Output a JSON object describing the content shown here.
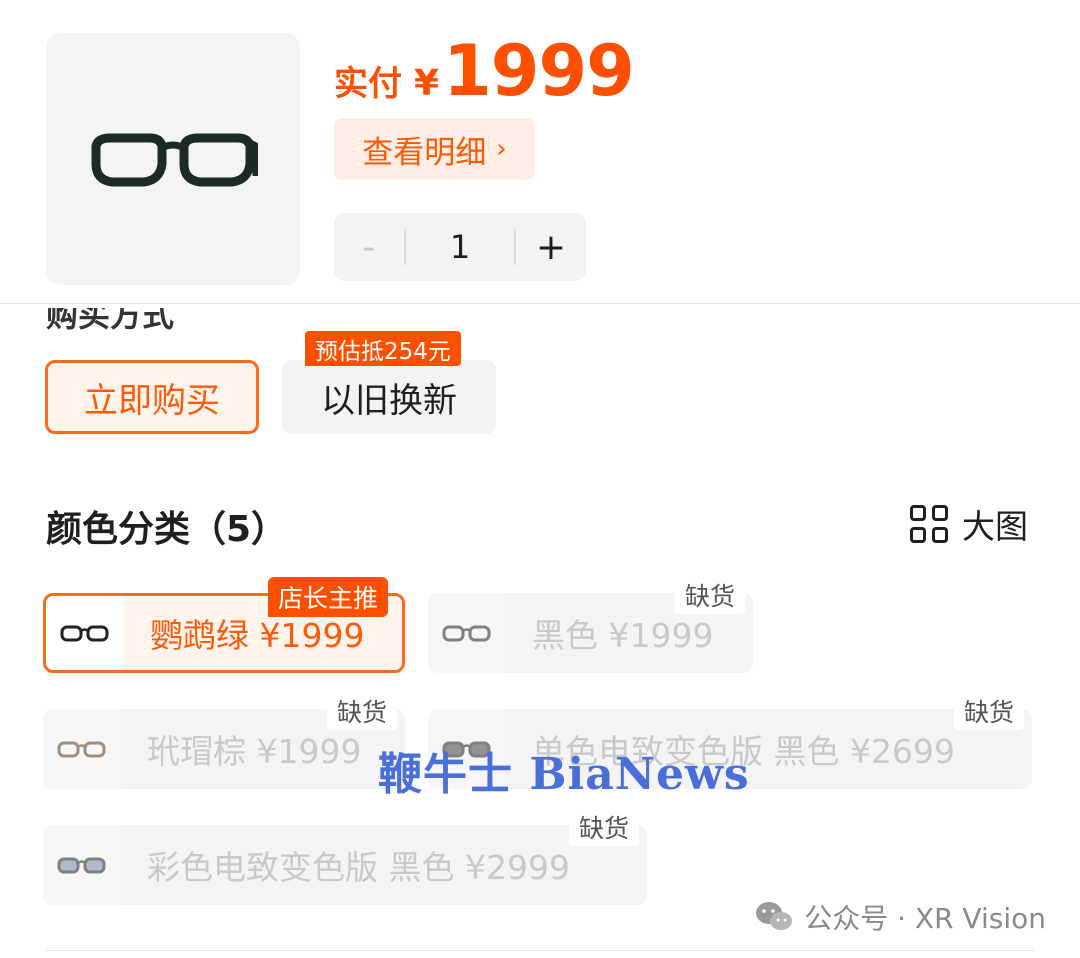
{
  "product": {
    "thumbnail_icon": "smart-glasses-icon",
    "price_label": "实付",
    "currency": "¥",
    "price": "1999",
    "detail_label": "查看明细",
    "quantity": "1",
    "minus_symbol": "-",
    "plus_symbol": "+"
  },
  "purchase": {
    "section_title": "购买方式",
    "options": [
      {
        "label": "立即购买",
        "selected": true
      },
      {
        "label": "以旧换新",
        "badge": "预估抵254元",
        "selected": false
      }
    ]
  },
  "colors": {
    "heading": "颜色分类（5）",
    "big_view_label": "大图",
    "variants": [
      {
        "label": "鹦鹉绿  ¥1999",
        "badge": "店长主推",
        "selected": true,
        "out_of_stock": false
      },
      {
        "label": "黑色  ¥1999",
        "badge": "缺货",
        "selected": false,
        "out_of_stock": true
      },
      {
        "label": "玳瑁棕  ¥1999",
        "badge": "缺货",
        "selected": false,
        "out_of_stock": true
      },
      {
        "label": "单色电致变色版 黑色  ¥2699",
        "badge": "缺货",
        "selected": false,
        "out_of_stock": true
      },
      {
        "label": "彩色电致变色版 黑色  ¥2999",
        "badge": "缺货",
        "selected": false,
        "out_of_stock": true
      }
    ]
  },
  "overlay": {
    "watermark": "鞭牛士 BiaNews",
    "credit": "公众号 · XR Vision"
  },
  "colors_theme": {
    "accent": "#ff4f00",
    "accent_bg": "#fff4ec",
    "oos_text": "#c9c9cc"
  }
}
